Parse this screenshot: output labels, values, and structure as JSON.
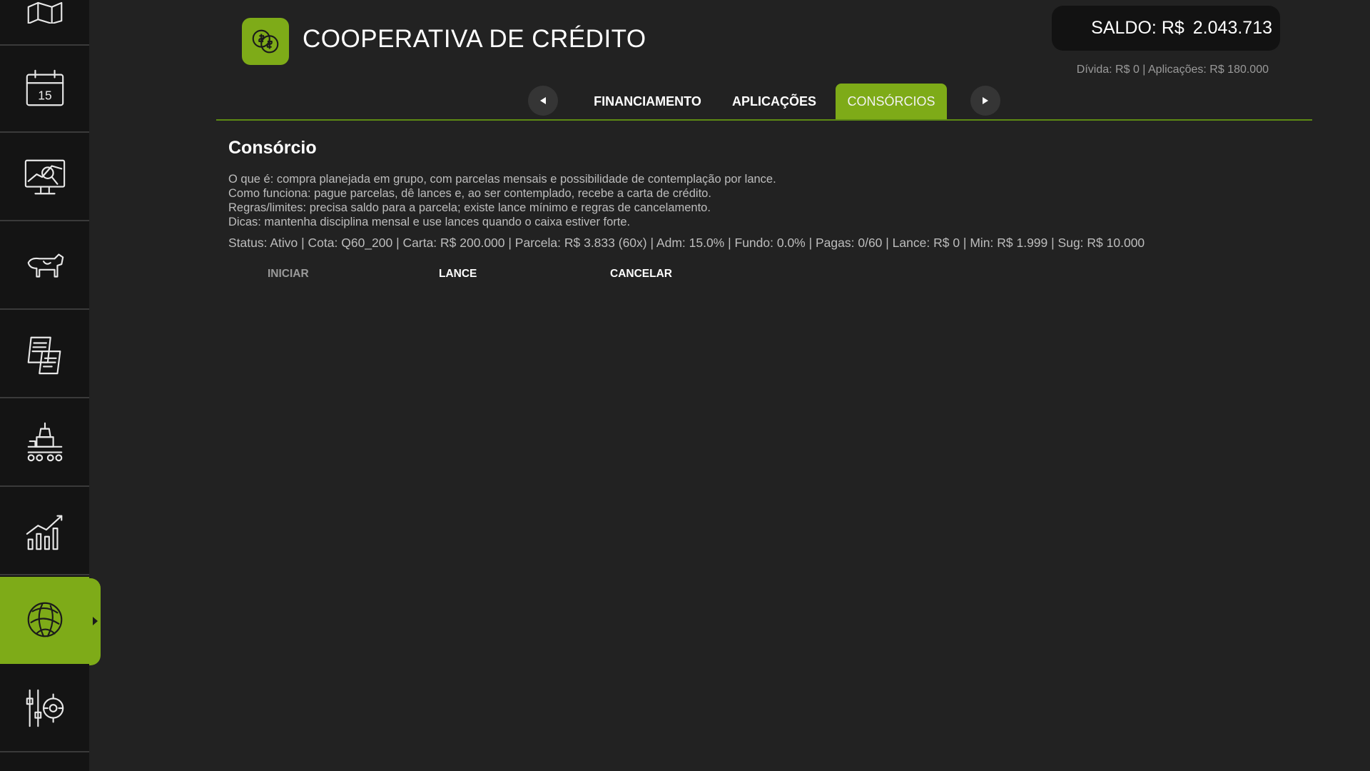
{
  "header": {
    "title": "COOPERATIVA DE CRÉDITO",
    "balance_label": "SALDO: R$",
    "balance_value": "2.043.713",
    "sub_balance": "Dívida: R$  0 | Aplicações: R$  180.000"
  },
  "sidebar": {
    "items": [
      {
        "icon": "map-icon"
      },
      {
        "icon": "calendar-icon",
        "label": "15"
      },
      {
        "icon": "monitor-chart-icon"
      },
      {
        "icon": "cow-icon"
      },
      {
        "icon": "contracts-icon"
      },
      {
        "icon": "production-icon"
      },
      {
        "icon": "statistics-icon"
      },
      {
        "icon": "finance-globe-icon",
        "active": true
      },
      {
        "icon": "settings-icon"
      }
    ]
  },
  "tabs": [
    {
      "label": "FINANCIAMENTO"
    },
    {
      "label": "APLICAÇÕES"
    },
    {
      "label": "CONSÓRCIOS",
      "active": true
    }
  ],
  "content": {
    "title": "Consórcio",
    "desc": [
      "O que é: compra planejada em grupo, com parcelas mensais e possibilidade de contemplação por lance.",
      "Como funciona: pague parcelas, dê lances e, ao ser contemplado, recebe a carta de crédito.",
      "Regras/limites: precisa saldo para a parcela; existe lance mínimo e regras de cancelamento.",
      "Dicas: mantenha disciplina mensal e use lances quando o caixa estiver forte."
    ],
    "status": "Status: Ativo | Cota: Q60_200 | Carta: R$  200.000 | Parcela: R$  3.833 (60x) | Adm: 15.0% | Fundo: 0.0% | Pagas: 0/60 | Lance: R$  0 | Min: R$  1.999 | Sug: R$  10.000",
    "actions": {
      "start": "INICIAR",
      "bid": "LANCE",
      "cancel": "CANCELAR"
    }
  },
  "colors": {
    "accent": "#7eab18",
    "background": "#222222",
    "sidebar": "#141414"
  }
}
